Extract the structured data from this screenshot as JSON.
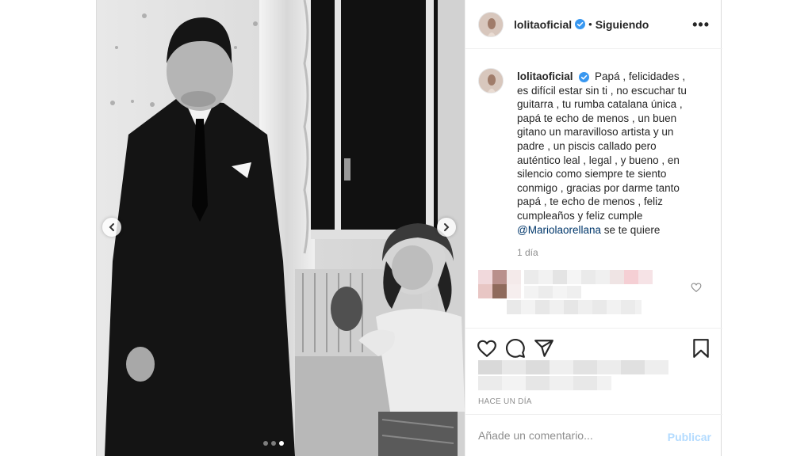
{
  "header": {
    "username": "lolitaoficial",
    "bullet": "•",
    "follow_status": "Siguiendo",
    "more_label": "•••"
  },
  "caption": {
    "username": "lolitaoficial",
    "text": "Papá , felicidades , es difícil estar sin ti , no escuchar tu guitarra , tu rumba catalana única , papá te echo de menos , un buen gitano un maravilloso artista y un padre , un piscis callado pero auténtico leal , legal , y bueno , en silencio como siempre te siento conmigo , gracias por darme tanto papá , te echo de menos , feliz cumpleaños y feliz cumple",
    "mention": "@Mariolaorellana",
    "text_after": "se te quiere",
    "time": "1 día"
  },
  "post_meta": {
    "ago": "HACE UN DÍA"
  },
  "comment_box": {
    "placeholder": "Añade un comentario...",
    "publish_label": "Publicar"
  },
  "carousel": {
    "slides": 3,
    "active_slide": 3
  },
  "icons": {
    "verified": "verified-badge-icon",
    "like": "heart-icon",
    "comment": "comment-bubble-icon",
    "share": "paper-plane-icon",
    "save": "bookmark-icon",
    "prev": "chevron-left-icon",
    "next": "chevron-right-icon"
  },
  "colors": {
    "verified_blue": "#3897f0",
    "link": "#00376b",
    "publish_disabled": "#b3dbff",
    "muted": "#8e8e8e"
  }
}
